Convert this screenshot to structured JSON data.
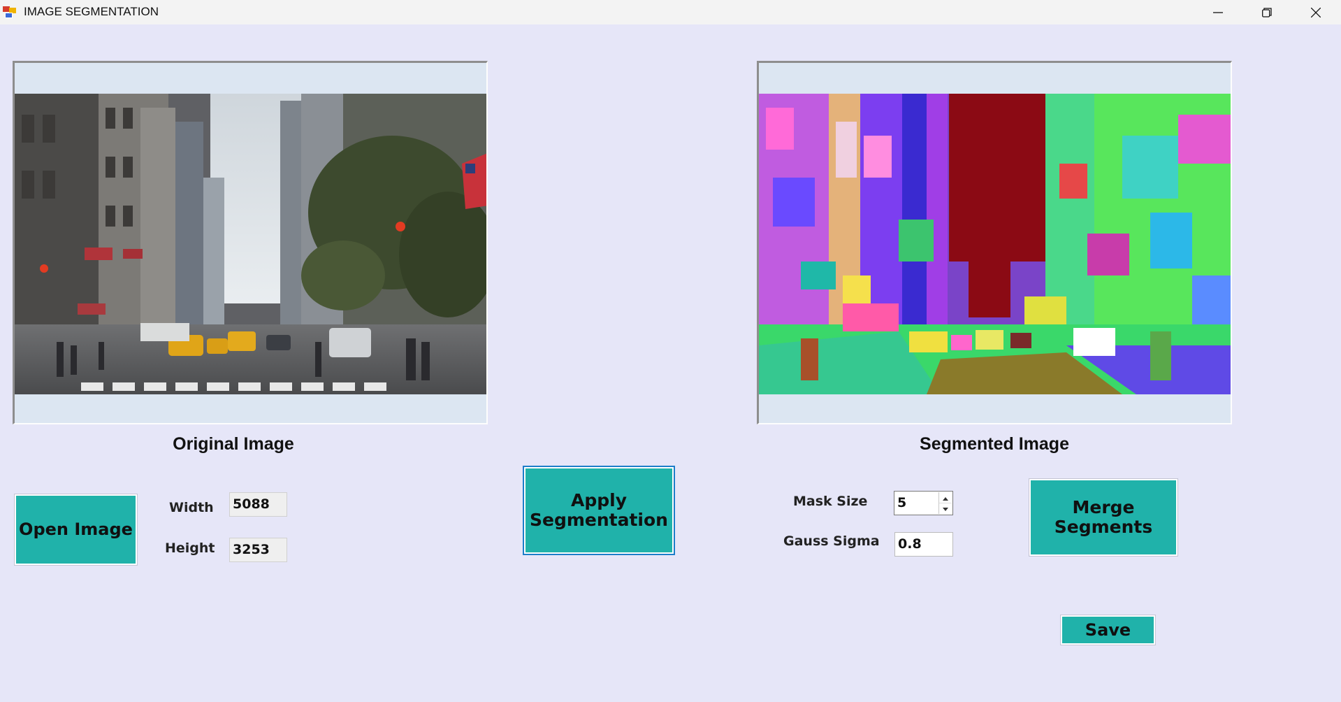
{
  "window": {
    "title": "IMAGE SEGMENTATION",
    "controls": [
      "minimize-icon",
      "restore-icon",
      "close-icon"
    ]
  },
  "left_panel": {
    "caption": "Original Image",
    "open_button": "Open Image",
    "width_label": "Width",
    "width_value": "5088",
    "height_label": "Height",
    "height_value": "3253"
  },
  "center": {
    "apply_button": "Apply Segmentation"
  },
  "right_panel": {
    "caption": "Segmented Image",
    "mask_size_label": "Mask Size",
    "mask_size_value": "5",
    "gauss_sigma_label": "Gauss Sigma",
    "gauss_sigma_value": "0.8",
    "merge_button": "Merge Segments",
    "save_button": "Save"
  },
  "colors": {
    "background": "#e6e6f8",
    "button": "#20b2aa",
    "image_frame": "#dce6f2",
    "segment_sky": "#8b0a14"
  }
}
